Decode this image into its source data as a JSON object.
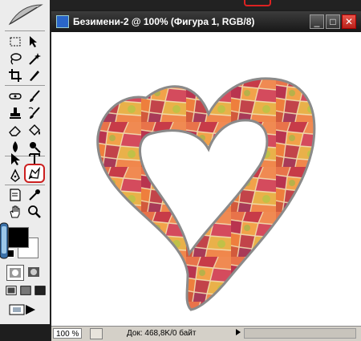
{
  "window": {
    "title": "Безимени-2 @ 100% (Фигура 1, RGB/8)",
    "buttons": {
      "minimize": "_",
      "maximize": "□",
      "close": "✕"
    }
  },
  "statusbar": {
    "zoom": "100 %",
    "doc_info": "Док: 468,8K/0 байт"
  },
  "toolbox": {
    "tools": [
      "rectangular-marquee-icon",
      "move-icon",
      "lasso-icon",
      "magic-wand-icon",
      "crop-icon",
      "slice-icon",
      "healing-brush-icon",
      "brush-icon",
      "clone-stamp-icon",
      "history-brush-icon",
      "eraser-icon",
      "paint-bucket-icon",
      "blur-icon",
      "dodge-icon",
      "path-selection-icon",
      "type-icon",
      "pen-icon",
      "custom-shape-icon",
      "notes-icon",
      "eyedropper-icon",
      "hand-icon",
      "zoom-icon"
    ],
    "highlighted_tool": "custom-shape-icon",
    "highlight_color": "#cc1f1f",
    "foreground_color": "#000000",
    "background_color": "#ffffff"
  },
  "colors": {
    "titlebar": "#1c1c1c",
    "canvas": "#ffffff",
    "heart_outline": "#8a8a8a"
  }
}
